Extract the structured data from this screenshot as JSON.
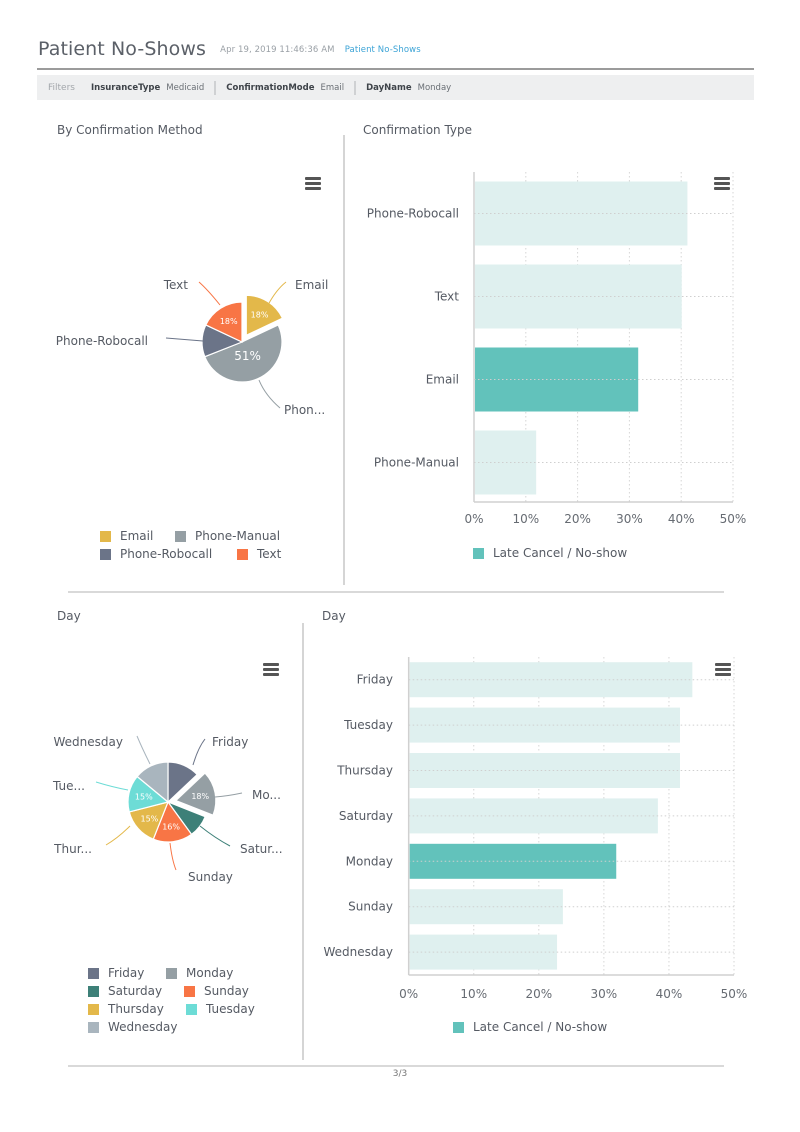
{
  "header": {
    "title": "Patient No-Shows",
    "timestamp": "Apr 19, 2019 11:46:36 AM",
    "link": "Patient No-Shows"
  },
  "filters": {
    "label": "Filters",
    "items": [
      {
        "key": "InsuranceType",
        "value": "Medicaid"
      },
      {
        "key": "ConfirmationMode",
        "value": "Email"
      },
      {
        "key": "DayName",
        "value": "Monday"
      }
    ]
  },
  "colors": {
    "highlight_bar": "#62c2bb",
    "faded_bar": "#dff0ef",
    "link": "#3ba3d6"
  },
  "footer": {
    "page": "3/3"
  },
  "chart_data": [
    {
      "id": "confirmation-pie",
      "type": "pie",
      "title": "By Confirmation Method",
      "selected": "Email",
      "slices": [
        {
          "label": "Email",
          "display_label": "Email",
          "value": 18,
          "color": "#e3b84a",
          "pct_label": "18%"
        },
        {
          "label": "Phone-Manual",
          "display_label": "Phon...",
          "value": 51,
          "color": "#959fa4",
          "pct_label": "51%"
        },
        {
          "label": "Phone-Robocall",
          "display_label": "Phone-Robocall",
          "value": 13,
          "color": "#6b7488",
          "pct_label": ""
        },
        {
          "label": "Text",
          "display_label": "Text",
          "value": 18,
          "color": "#f87545",
          "pct_label": "18%"
        }
      ],
      "legend": [
        "Email",
        "Phone-Manual",
        "Phone-Robocall",
        "Text"
      ],
      "legend_placement": "bottom"
    },
    {
      "id": "confirmation-bar",
      "type": "bar",
      "orientation": "horizontal",
      "title": "Confirmation Type",
      "categories": [
        "Phone-Robocall",
        "Text",
        "Email",
        "Phone-Manual"
      ],
      "series": [
        {
          "name": "Late Cancel / No-show",
          "values": [
            41.2,
            40.1,
            31.7,
            12.0
          ]
        }
      ],
      "selected": "Email",
      "xlim": [
        0,
        50
      ],
      "xticks": [
        "0%",
        "10%",
        "20%",
        "30%",
        "40%",
        "50%"
      ],
      "grid": true,
      "legend": [
        "Late Cancel / No-show"
      ],
      "legend_placement": "bottom"
    },
    {
      "id": "day-pie",
      "type": "pie",
      "title": "Day",
      "selected": "Monday",
      "slices": [
        {
          "label": "Friday",
          "display_label": "Friday",
          "value": 13,
          "color": "#6b7488",
          "pct_label": ""
        },
        {
          "label": "Monday",
          "display_label": "Mo...",
          "value": 18,
          "color": "#959fa4",
          "pct_label": "18%"
        },
        {
          "label": "Saturday",
          "display_label": "Satur...",
          "value": 9,
          "color": "#3d8078",
          "pct_label": ""
        },
        {
          "label": "Sunday",
          "display_label": "Sunday",
          "value": 16,
          "color": "#f87545",
          "pct_label": "16%"
        },
        {
          "label": "Thursday",
          "display_label": "Thur...",
          "value": 15,
          "color": "#e3b84a",
          "pct_label": "15%"
        },
        {
          "label": "Tuesday",
          "display_label": "Tue...",
          "value": 15,
          "color": "#6ddcd6",
          "pct_label": "15%"
        },
        {
          "label": "Wednesday",
          "display_label": "Wednesday",
          "value": 14,
          "color": "#a9b5be",
          "pct_label": ""
        }
      ],
      "legend": [
        "Friday",
        "Monday",
        "Saturday",
        "Sunday",
        "Thursday",
        "Tuesday",
        "Wednesday"
      ],
      "legend_placement": "bottom"
    },
    {
      "id": "day-bar",
      "type": "bar",
      "orientation": "horizontal",
      "title": "Day",
      "categories": [
        "Friday",
        "Tuesday",
        "Thursday",
        "Saturday",
        "Monday",
        "Sunday",
        "Wednesday"
      ],
      "series": [
        {
          "name": "Late Cancel / No-show",
          "values": [
            43.6,
            41.7,
            41.7,
            38.3,
            31.9,
            23.7,
            22.8
          ]
        }
      ],
      "selected": "Monday",
      "xlim": [
        0,
        50
      ],
      "xticks": [
        "0%",
        "10%",
        "20%",
        "30%",
        "40%",
        "50%"
      ],
      "grid": true,
      "legend": [
        "Late Cancel / No-show"
      ],
      "legend_placement": "bottom"
    }
  ]
}
